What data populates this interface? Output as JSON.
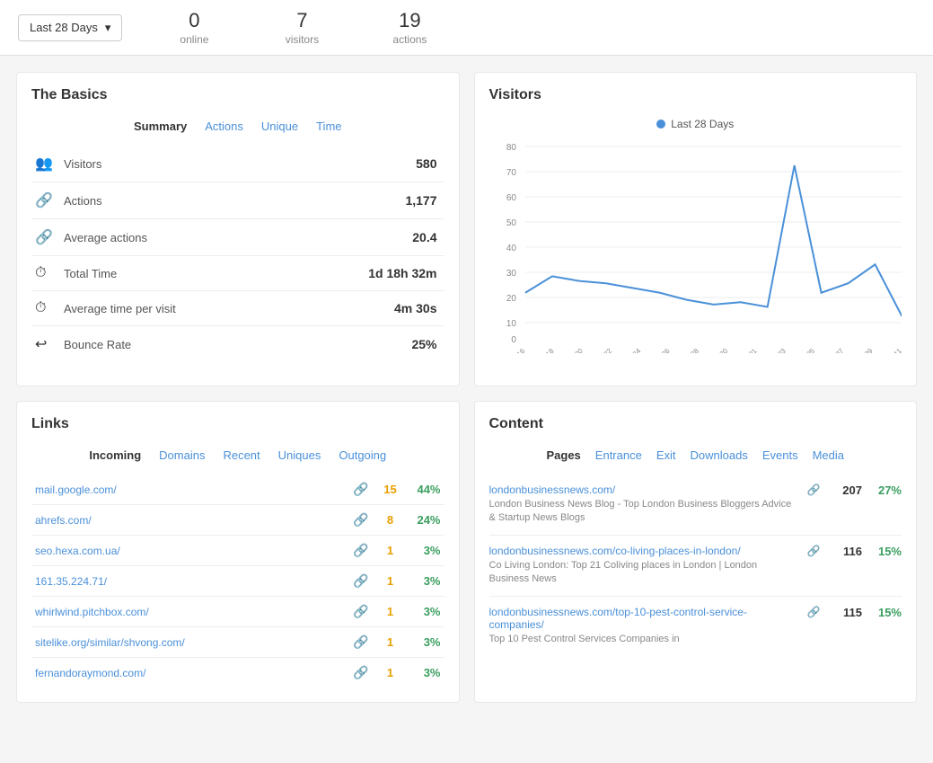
{
  "topbar": {
    "dateFilter": "Last 28 Days",
    "stats": [
      {
        "id": "online",
        "value": "0",
        "label": "online"
      },
      {
        "id": "visitors",
        "value": "7",
        "label": "visitors"
      },
      {
        "id": "actions",
        "value": "19",
        "label": "actions"
      }
    ]
  },
  "basics": {
    "title": "The Basics",
    "tabs": [
      "Summary",
      "Actions",
      "Unique",
      "Time"
    ],
    "activeTab": "Summary",
    "rows": [
      {
        "id": "visitors",
        "icon": "👥",
        "label": "Visitors",
        "value": "580"
      },
      {
        "id": "actions",
        "icon": "🖱️",
        "label": "Actions",
        "value": "1,177"
      },
      {
        "id": "avg-actions",
        "icon": "🔗",
        "label": "Average actions",
        "value": "20.4"
      },
      {
        "id": "total-time",
        "icon": "⏱️",
        "label": "Total Time",
        "value": "1d 18h 32m"
      },
      {
        "id": "avg-time",
        "icon": "⏱️",
        "label": "Average time per visit",
        "value": "4m 30s"
      },
      {
        "id": "bounce-rate",
        "icon": "↩️",
        "label": "Bounce Rate",
        "value": "25%"
      }
    ]
  },
  "visitors_chart": {
    "title": "Visitors",
    "legend": "Last 28 Days",
    "yLabels": [
      "0",
      "10",
      "20",
      "30",
      "40",
      "50",
      "60",
      "70",
      "80"
    ],
    "xLabels": [
      "2020-12-16",
      "2020-12-18",
      "2020-12-20",
      "2020-12-22",
      "2020-12-24",
      "2020-12-26",
      "2020-12-28",
      "2020-12-30",
      "2021-01-01",
      "2021-01-03",
      "2021-01-05",
      "2021-01-07",
      "2021-01-09",
      "2021-01-11"
    ],
    "points": [
      18,
      25,
      23,
      22,
      20,
      18,
      15,
      13,
      14,
      12,
      72,
      18,
      22,
      30,
      8
    ]
  },
  "links": {
    "title": "Links",
    "tabs": [
      "Incoming",
      "Domains",
      "Recent",
      "Uniques",
      "Outgoing"
    ],
    "activeTab": "Incoming",
    "rows": [
      {
        "url": "mail.google.com/",
        "count": "15",
        "pct": "44%"
      },
      {
        "url": "ahrefs.com/",
        "count": "8",
        "pct": "24%"
      },
      {
        "url": "seo.hexa.com.ua/",
        "count": "1",
        "pct": "3%"
      },
      {
        "url": "161.35.224.71/",
        "count": "1",
        "pct": "3%"
      },
      {
        "url": "whirlwind.pitchbox.com/",
        "count": "1",
        "pct": "3%"
      },
      {
        "url": "sitelike.org/similar/shvong.com/",
        "count": "1",
        "pct": "3%"
      },
      {
        "url": "fernandoraymond.com/",
        "count": "1",
        "pct": "3%"
      }
    ]
  },
  "content": {
    "title": "Content",
    "tabs": [
      "Pages",
      "Entrance",
      "Exit",
      "Downloads",
      "Events",
      "Media"
    ],
    "activeTab": "Pages",
    "rows": [
      {
        "url": "londonbusinessnews.com/",
        "desc": "London Business News Blog - Top London Business Bloggers Advice & Startup News Blogs",
        "count": "207",
        "pct": "27%"
      },
      {
        "url": "londonbusinessnews.com/co-living-places-in-london/",
        "desc": "Co Living London: Top 21 Coliving places in London | London Business News",
        "count": "116",
        "pct": "15%"
      },
      {
        "url": "londonbusinessnews.com/top-10-pest-control-service-companies/",
        "desc": "Top 10 Pest Control Services Companies in",
        "count": "115",
        "pct": "15%"
      }
    ]
  }
}
